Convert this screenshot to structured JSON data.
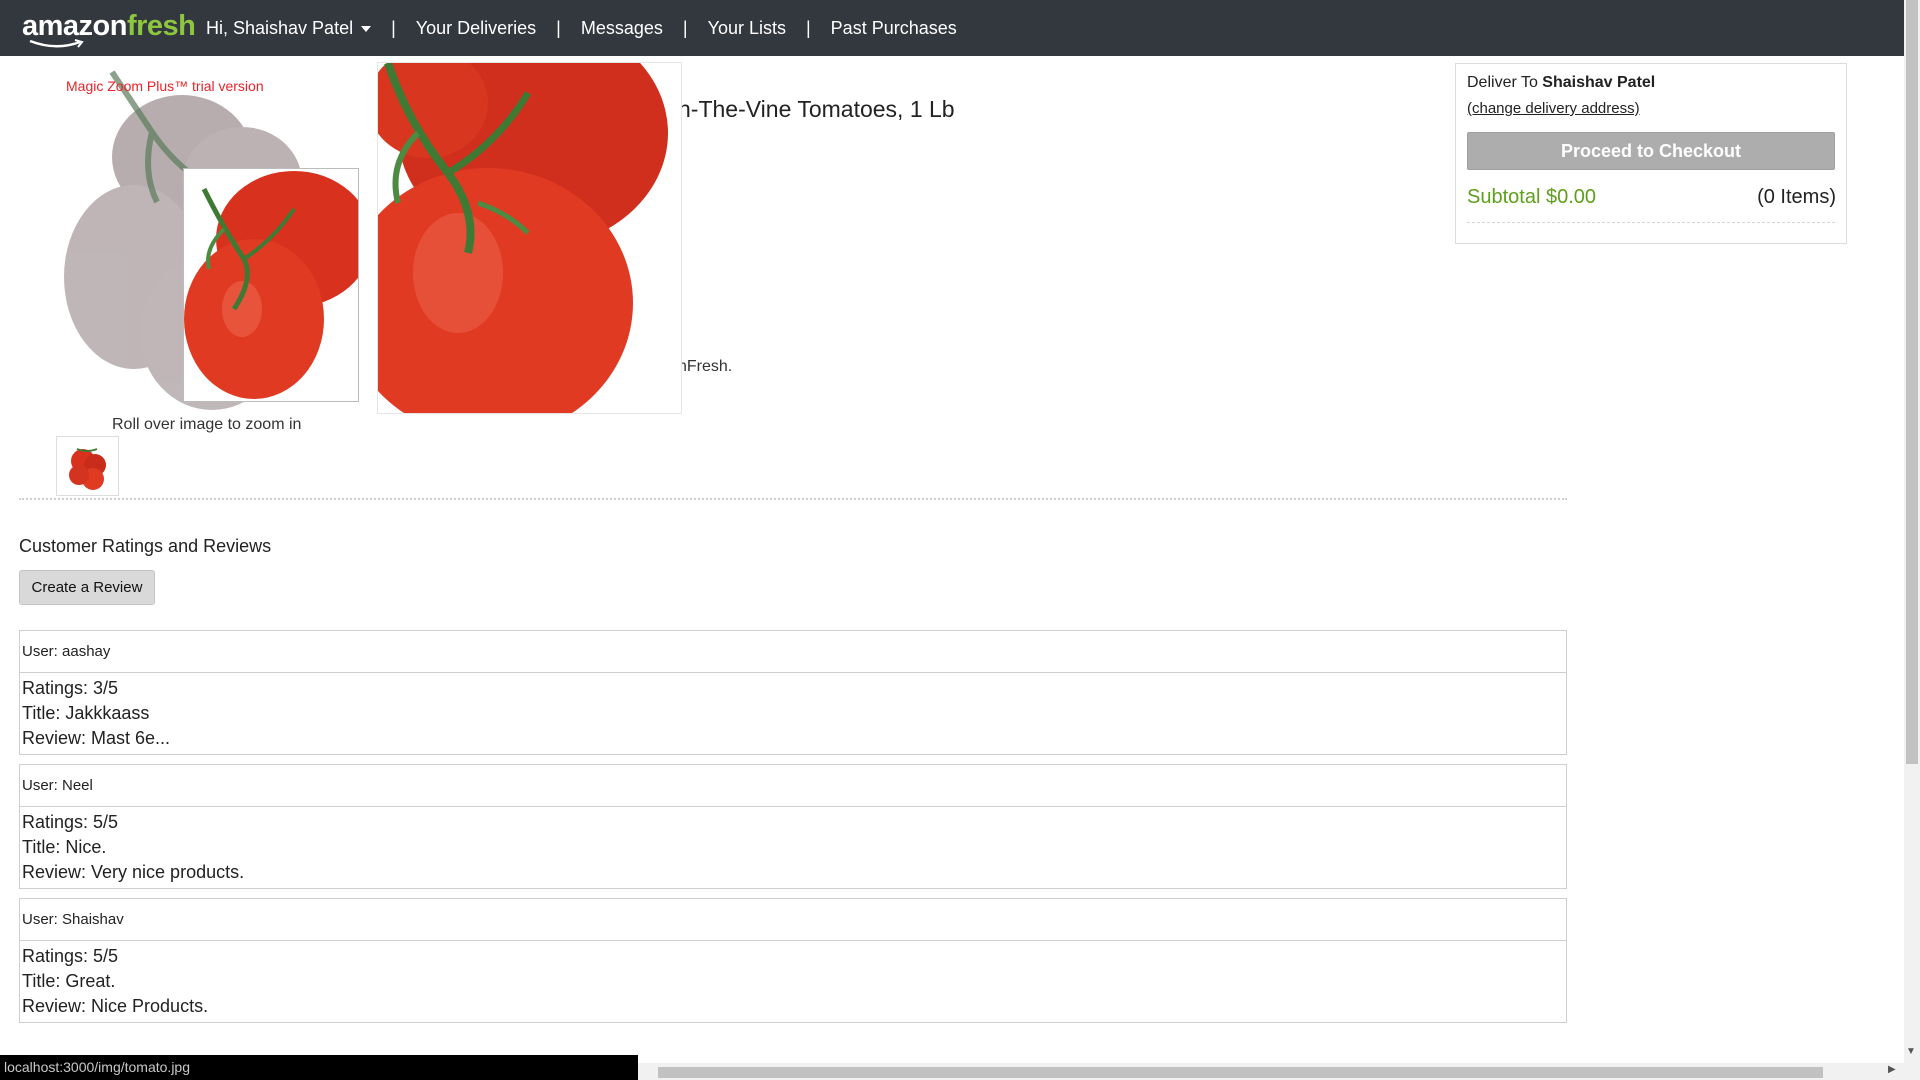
{
  "nav": {
    "logo_part1": "amazon",
    "logo_part2": "fresh",
    "greeting": "Hi, Shaishav Patel",
    "separator": "|",
    "items": [
      {
        "label": "Your Deliveries"
      },
      {
        "label": "Messages"
      },
      {
        "label": "Your Lists"
      },
      {
        "label": "Past Purchases"
      }
    ]
  },
  "product": {
    "trial_note": "Magic Zoom Plus™ trial version",
    "title_visible": "n-The-Vine Tomatoes, 1 Lb",
    "seller_visible": "nFresh.",
    "zoom_hint": "Roll over image to zoom in"
  },
  "reviews": {
    "heading": "Customer Ratings and Reviews",
    "create_button": "Create a Review",
    "items": [
      {
        "user": "User: aashay",
        "rating": "Ratings: 3/5",
        "title": "Title: Jakkkaass",
        "review": "Review: Mast 6e..."
      },
      {
        "user": "User: Neel",
        "rating": "Ratings: 5/5",
        "title": "Title: Nice.",
        "review": "Review: Very nice products."
      },
      {
        "user": "User: Shaishav",
        "rating": "Ratings: 5/5",
        "title": "Title: Great.",
        "review": "Review: Nice Products."
      }
    ]
  },
  "cart": {
    "deliver_label": "Deliver To",
    "deliver_name": "Shaishav Patel",
    "change_address": "(change delivery address)",
    "checkout_button": "Proceed to Checkout",
    "subtotal": "Subtotal $0.00",
    "items_count": "(0 Items)"
  },
  "status_bar": {
    "url": "localhost:3000/img/tomato.jpg"
  },
  "colors": {
    "nav_bg": "#32383e",
    "brand_green": "#8dc63f",
    "subtotal_green": "#5e9f1c",
    "trial_red": "#e8232a",
    "tomato_red": "#e03a22"
  },
  "icons": {
    "caret": "caret-down-icon",
    "smile": "amazon-smile-icon"
  }
}
